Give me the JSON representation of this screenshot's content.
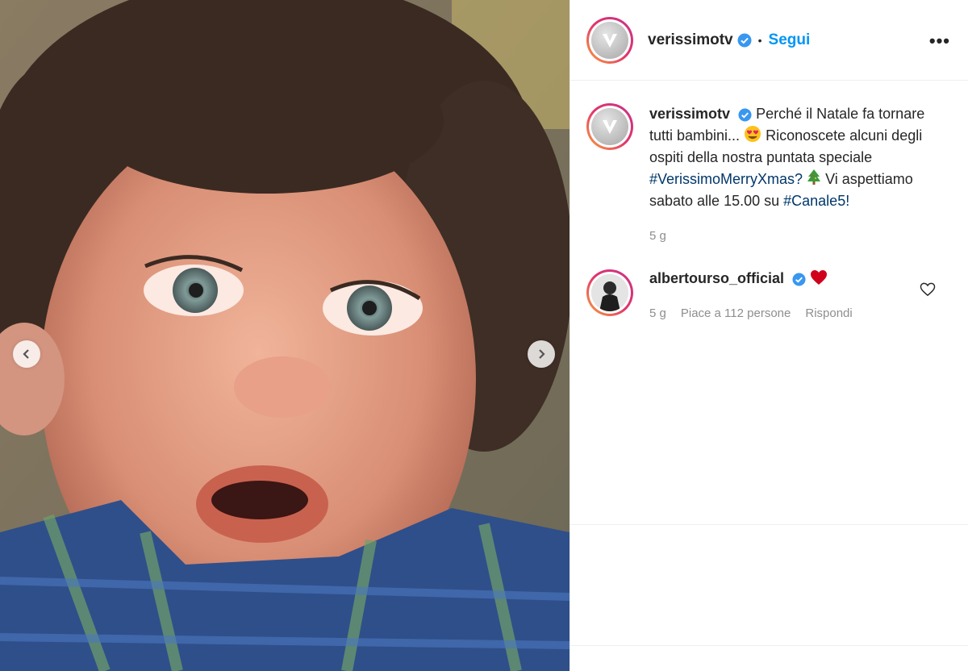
{
  "post": {
    "author": {
      "username": "verissimotv",
      "follow_label": "Segui",
      "more_label": "•••"
    },
    "caption": {
      "username": "verissimotv",
      "text_1": "Perché il Natale fa tornare tutti bambini...",
      "text_2": "Riconoscete alcuni degli ospiti della nostra puntata speciale",
      "hashtag_1": "#VerissimoMerryXmas?",
      "text_3": "Vi aspettiamo sabato alle 15.00 su",
      "hashtag_2": "#Canale5!",
      "time": "5 g"
    },
    "comment": {
      "username": "albertourso_official",
      "time": "5 g",
      "likes": "Piace a 112 persone",
      "reply_label": "Rispondi"
    },
    "icons": {
      "verified": "verified-badge-icon",
      "heart_eyes": "heart-eyes-emoji",
      "tree": "christmas-tree-emoji",
      "heart": "red-heart-emoji",
      "like": "heart-outline-icon",
      "prev": "chevron-left-icon",
      "next": "chevron-right-icon"
    },
    "colors": {
      "link": "#0095f6",
      "hashtag": "#00376b",
      "meta": "#8e8e8e"
    }
  }
}
